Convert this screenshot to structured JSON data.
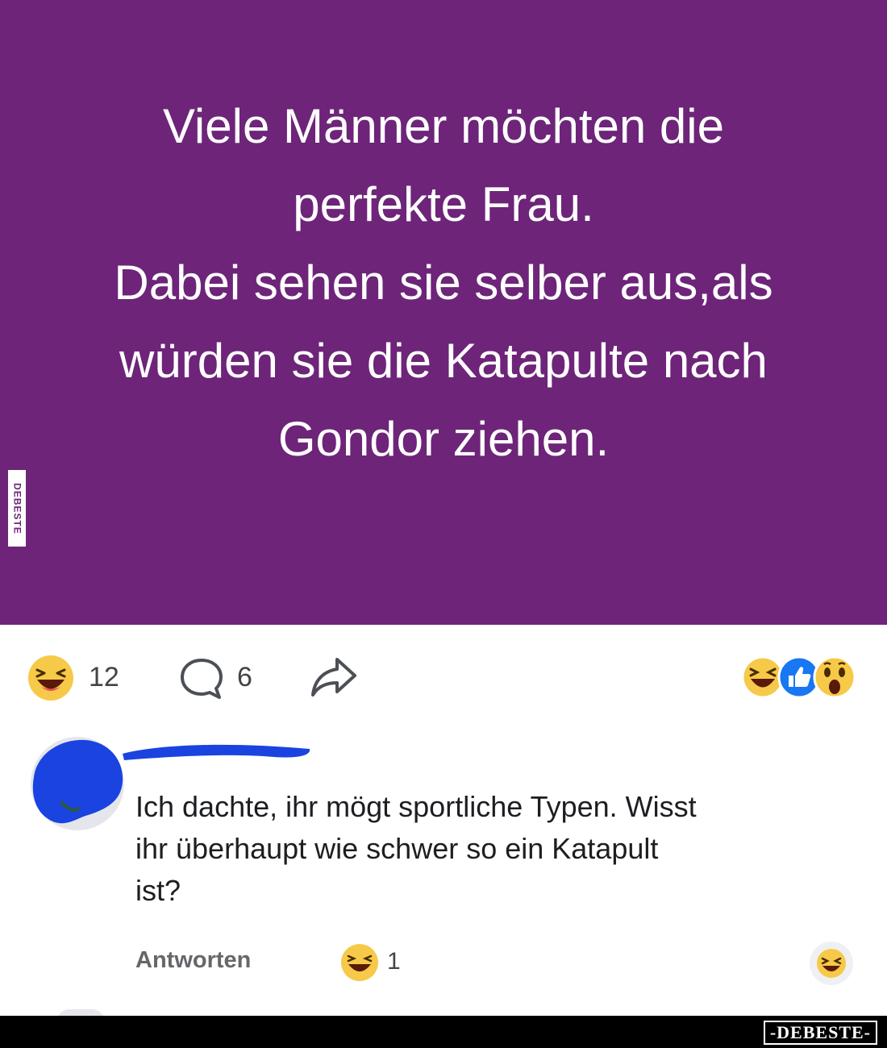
{
  "post": {
    "background_color": "#6d2479",
    "text_lines": [
      "Viele Männer möchten die",
      "perfekte Frau.",
      "Dabei sehen sie selber aus,als",
      "würden sie die Katapulte nach",
      "Gondor ziehen."
    ],
    "side_watermark": "DEBESTE"
  },
  "actions": {
    "reaction_icon": "laughing-emoji-icon",
    "reaction_count": "12",
    "comment_icon": "comment-bubble-icon",
    "comment_count": "6",
    "share_icon": "share-arrow-icon",
    "reaction_summary_icons": [
      "haha-reaction-icon",
      "like-reaction-icon",
      "wow-reaction-icon"
    ]
  },
  "comment": {
    "avatar_icon": "user-avatar-icon",
    "text_lines": [
      "Ich dachte, ihr mögt sportliche Typen. Wisst",
      "ihr überhaupt wie schwer so ein Katapult",
      "ist?"
    ],
    "reply_label": "Antworten",
    "reaction_icon": "laughing-emoji-icon",
    "reaction_count": "1",
    "react_button_icon": "laughing-emoji-icon"
  },
  "footer": {
    "watermark": "-DEBESTE-"
  },
  "colors": {
    "accent_purple": "#6d2479",
    "emoji_yellow": "#f7c948",
    "like_blue": "#1877f2",
    "redact_blue": "#1a43e0"
  }
}
